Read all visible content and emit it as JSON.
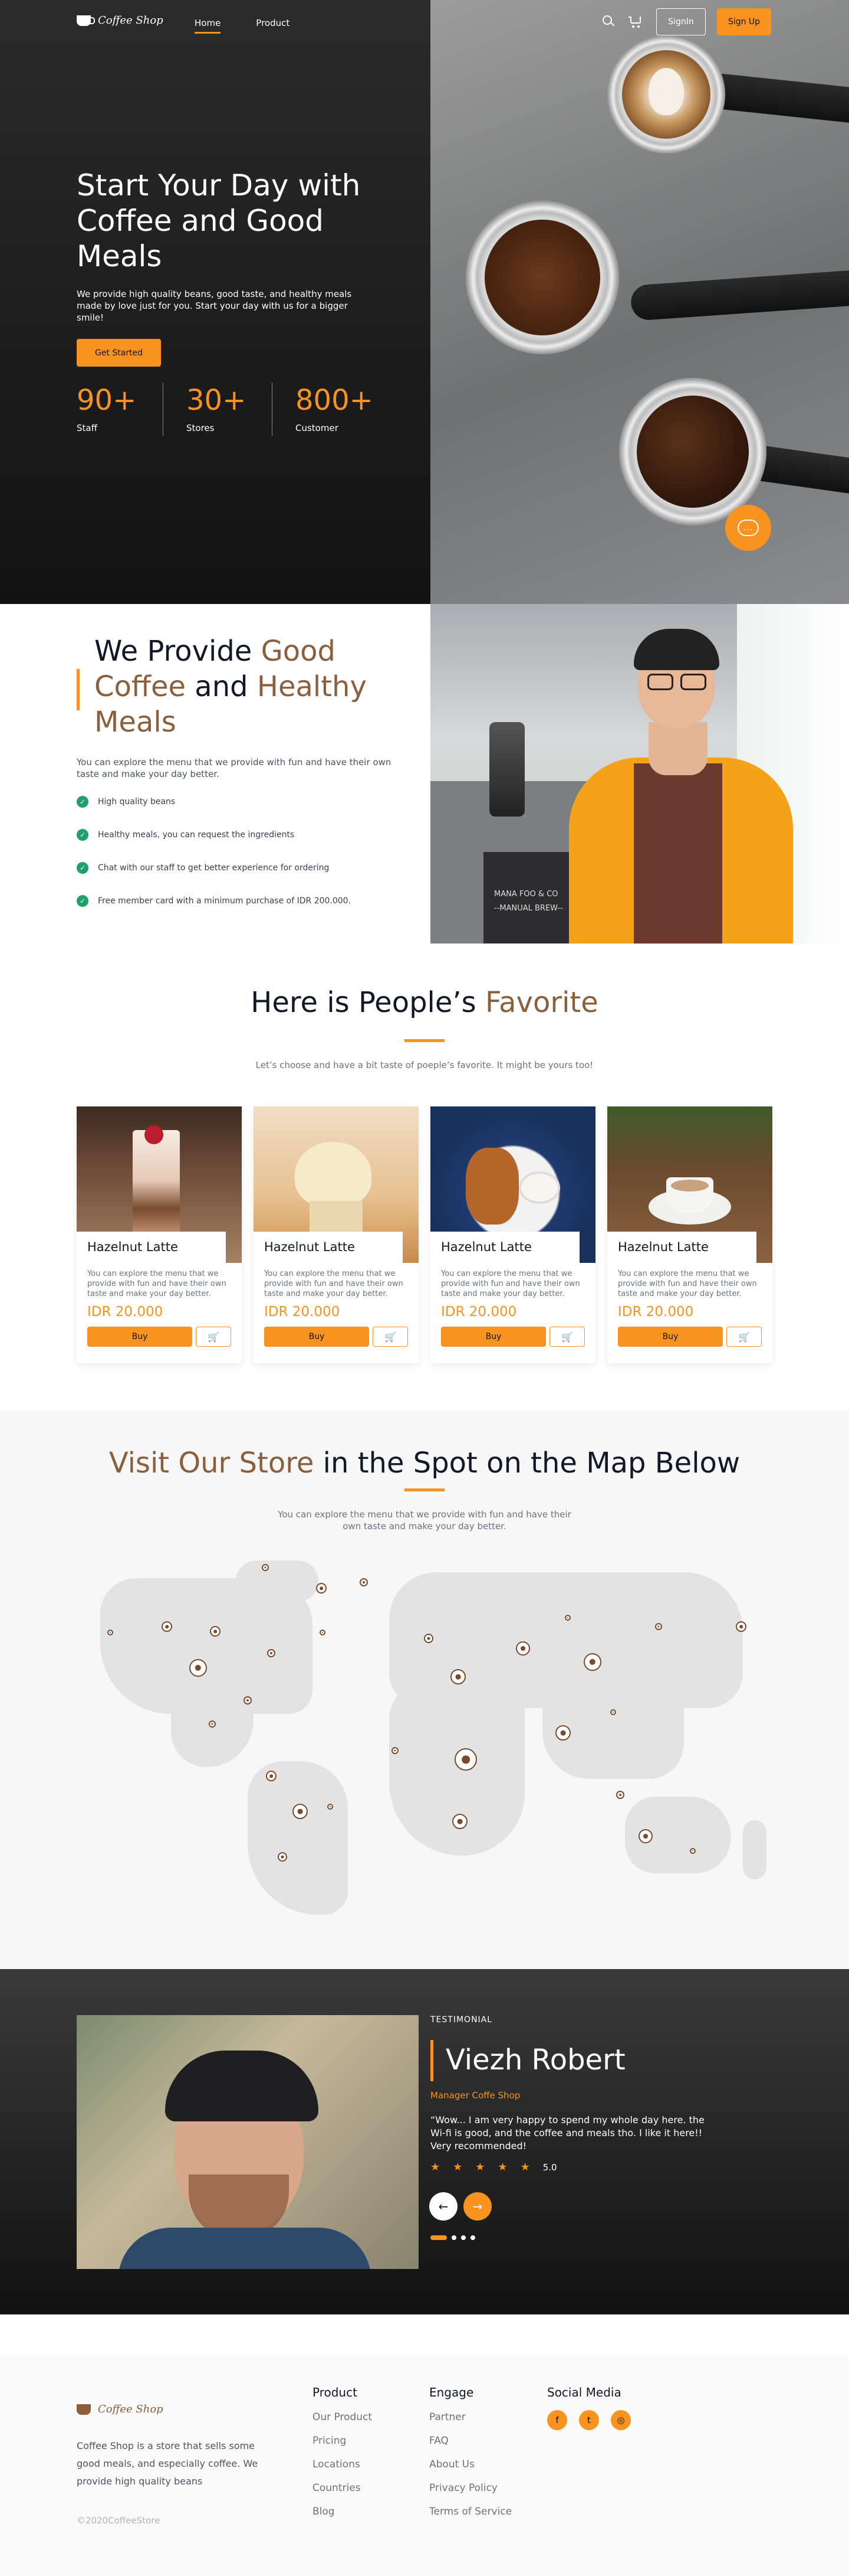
{
  "brand": {
    "name": "Coffee Shop"
  },
  "nav": {
    "items": [
      "Home",
      "Product"
    ],
    "signin": "SignIn",
    "signup": "Sign Up"
  },
  "hero": {
    "title": "Start Your Day with Coffee and Good Meals",
    "description": "We provide high quality beans, good taste, and healthy meals made by love just for you. Start your day with us for a bigger smile!",
    "cta": "Get Started",
    "stats": [
      {
        "value": "90+",
        "label": "Staff"
      },
      {
        "value": "30+",
        "label": "Stores"
      },
      {
        "value": "800+",
        "label": "Customer"
      }
    ],
    "chat_icon": "..."
  },
  "provide": {
    "title_parts": [
      "We Provide ",
      "Good Coffee",
      " and ",
      "Healthy Meals"
    ],
    "description": "You can explore the menu that we provide with fun and have their own taste and make your day better.",
    "features": [
      "High quality beans",
      "Healthy meals, you can request the ingredients",
      "Chat with our staff to get better experience for ordering",
      "Free member card with a minimum purchase of IDR 200.000."
    ],
    "sign_text": [
      "MANA FOO & CO",
      "--MANUAL BREW--"
    ]
  },
  "favorite": {
    "title_parts": [
      "Here is People’s ",
      "Favorite"
    ],
    "subtitle": "Let’s choose and have a bit taste of poeple’s favorite. It might be yours too!",
    "products": [
      {
        "name": "Hazelnut Latte",
        "desc": "You can explore the menu that we provide with fun and have their own taste and make your day better.",
        "price": "IDR 20.000",
        "buy": "Buy"
      },
      {
        "name": "Hazelnut Latte",
        "desc": "You can explore the menu that we provide with fun and have their own taste and make your day better.",
        "price": "IDR 20.000",
        "buy": "Buy"
      },
      {
        "name": "Hazelnut Latte",
        "desc": "You can explore the menu that we provide with fun and have their own taste and make your day better.",
        "price": "IDR 20.000",
        "buy": "Buy"
      },
      {
        "name": "Hazelnut Latte",
        "desc": "You can explore the menu that we provide with fun and have their own taste and make your day better.",
        "price": "IDR 20.000",
        "buy": "Buy"
      }
    ]
  },
  "map_section": {
    "title_parts": [
      "Visit Our Store",
      " in the Spot on the Map Below"
    ],
    "subtitle": "You can explore the menu that we provide with fun and have their own taste and make your day better."
  },
  "testimonial": {
    "eyebrow": "TESTIMONIAL",
    "name": "Viezh Robert",
    "role": "Manager Coffe Shop",
    "quote": "“Wow... I am very happy to spend my whole day here. the Wi-fi is good, and the coffee and meals tho. I like it here!! Very recommended!",
    "rating": "5.0"
  },
  "footer": {
    "about": "Coffee Shop is a store that sells some good meals, and especially coffee. We provide high quality beans",
    "copyright": "©2020CoffeeStore",
    "columns": [
      {
        "title": "Product",
        "links": [
          "Our Product",
          "Pricing",
          "Locations",
          "Countries",
          "Blog"
        ]
      },
      {
        "title": "Engage",
        "links": [
          "Partner",
          "FAQ",
          "About Us",
          "Privacy Policy",
          "Terms of Service"
        ]
      }
    ],
    "social_title": "Social Media",
    "social_icons": [
      "facebook-icon",
      "twitter-icon",
      "instagram-icon"
    ]
  },
  "colors": {
    "accent": "#F7931E",
    "brown": "#8B5E3C",
    "dark": "#1E1E1E",
    "green": "#22A06B"
  }
}
